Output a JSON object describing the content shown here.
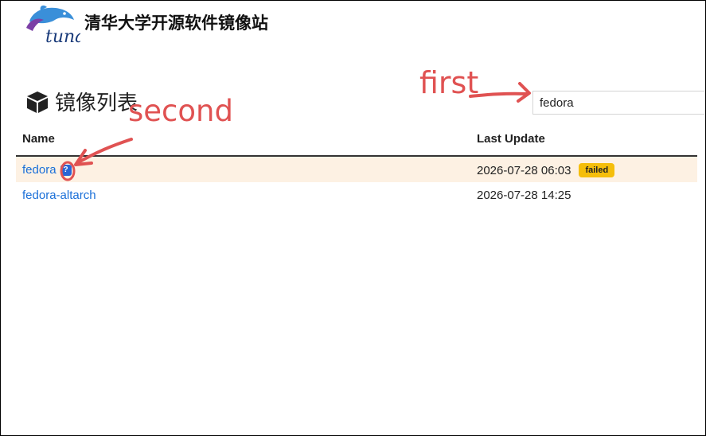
{
  "header": {
    "title": "清华大学开源软件镜像站",
    "logo_icon": "tuna-logo-icon"
  },
  "page": {
    "title": "镜像列表",
    "title_icon": "box-icon"
  },
  "search": {
    "value": "fedora"
  },
  "table": {
    "columns": [
      "Name",
      "Last Update"
    ],
    "rows": [
      {
        "name": "fedora",
        "has_help": true,
        "help_glyph": "?",
        "last_update": "2026-07-28 06:03",
        "status": "failed"
      },
      {
        "name": "fedora-altarch",
        "has_help": false,
        "last_update": "2026-07-28 14:25",
        "status": ""
      }
    ]
  },
  "annotations": {
    "first": "first",
    "second": "second",
    "color": "#e05252"
  },
  "colors": {
    "link": "#1a6fd8",
    "badge_failed": "#f5be0b",
    "row_highlight": "#fdf1e3"
  }
}
